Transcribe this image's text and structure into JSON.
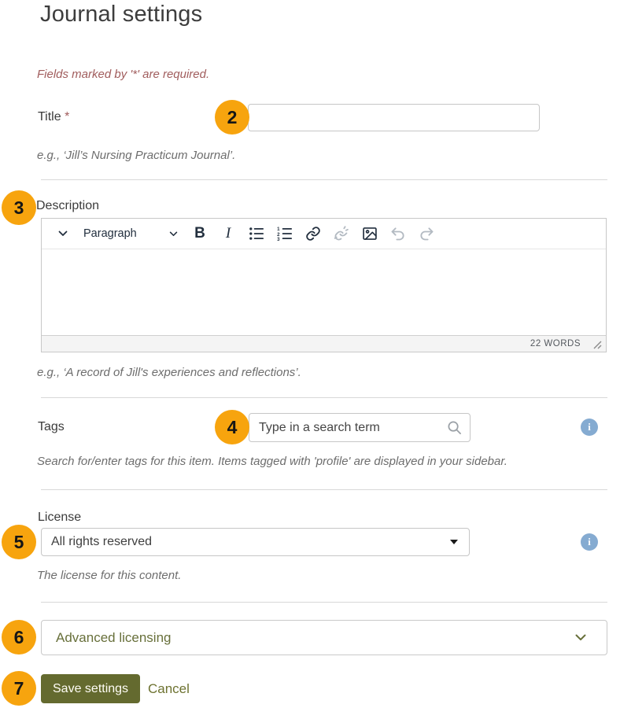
{
  "page": {
    "title": "Journal settings",
    "required_note": "Fields marked by '*' are required."
  },
  "title_field": {
    "badge": "2",
    "label": "Title",
    "required_marker": "*",
    "value": "",
    "hint": "e.g., ‘Jill’s Nursing Practicum Journal’."
  },
  "description_field": {
    "badge": "3",
    "label": "Description",
    "toolbar": {
      "paragraph_label": "Paragraph",
      "bold_glyph": "B",
      "italic_glyph": "I"
    },
    "word_count": "22 WORDS",
    "hint": "e.g., ‘A record of Jill's experiences and reflections’."
  },
  "tags_field": {
    "badge": "4",
    "label": "Tags",
    "placeholder": "Type in a search term",
    "hint": "Search for/enter tags for this item. Items tagged with 'profile' are displayed in your sidebar."
  },
  "license_field": {
    "badge": "5",
    "label": "License",
    "selected_option": "All rights reserved",
    "hint": "The license for this content."
  },
  "advanced_section": {
    "badge": "6",
    "label": "Advanced licensing"
  },
  "actions": {
    "badge": "7",
    "save_label": "Save settings",
    "cancel_label": "Cancel"
  },
  "icons": {
    "toolbar": [
      "chevron-down-icon",
      "paragraph-chevron-icon",
      "bold-icon",
      "italic-icon",
      "bullet-list-icon",
      "numbered-list-icon",
      "link-icon",
      "unlink-icon",
      "image-icon",
      "undo-icon",
      "redo-icon"
    ],
    "statusbar": "resize-handle-icon",
    "tags": "search-icon",
    "license": "caret-down-icon",
    "advanced": "chevron-down-icon",
    "help": "info-icon"
  },
  "colors": {
    "badge_bg": "#f7a40e",
    "save_button_bg": "#646a2f",
    "link_text": "#6d7230",
    "advanced_text": "#68703b",
    "info_icon_bg": "#85abd1",
    "required_text": "#a15d5d",
    "toolbar_icon": "#222f3e",
    "toolbar_icon_disabled": "#b3bac2",
    "hint_text": "#6d6d6d",
    "border": "#c6c6c6"
  }
}
